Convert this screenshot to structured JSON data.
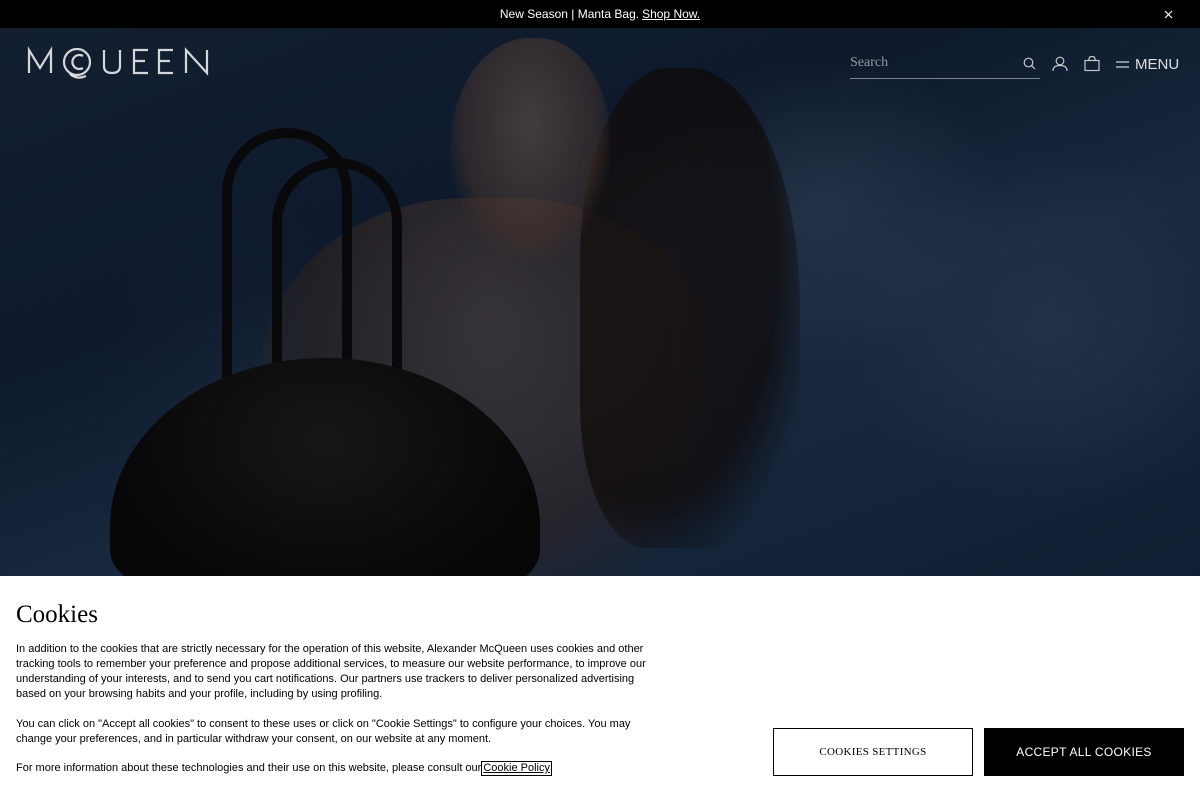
{
  "announcement": {
    "text": "New Season | Manta Bag.",
    "link": "Shop Now.",
    "close_icon": "close-icon"
  },
  "header": {
    "logo_text": "MCQUEEN",
    "search_placeholder": "Search",
    "icons": [
      "search-icon",
      "account-icon",
      "shopping-bag-icon",
      "hamburger-icon"
    ],
    "menu_label": "MENU"
  },
  "hero": {
    "image": "underwater model holding black handbag"
  },
  "cookies": {
    "title": "Cookies",
    "paragraph_1": "In addition to the cookies that are strictly necessary for the operation of this website, Alexander McQueen uses cookies and other tracking tools to remember your preference and propose additional services, to measure our website performance, to improve our understanding of your interests, and to send you cart notifications. Our partners use trackers to deliver personalized advertising based on your browsing habits and your profile, including by using profiling.",
    "paragraph_2": "You can click on \"Accept all cookies\" to consent to these uses or click on \"Cookie Settings\" to configure your choices. You may change your preferences, and in particular withdraw your consent, on our website at any moment.",
    "paragraph_3": "For more information about these technologies and their use on this website, please consult our",
    "policy_link": "Cookie Policy",
    "settings_button": "COOKIES SETTINGS",
    "accept_button": "ACCEPT ALL COOKIES"
  },
  "colors": {
    "announcement_bg": "#000000",
    "banner_bg": "#ffffff",
    "accept_bg": "#000000"
  }
}
